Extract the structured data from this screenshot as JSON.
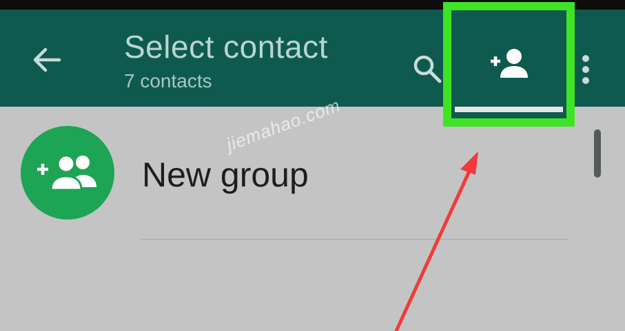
{
  "app_bar": {
    "title": "Select contact",
    "subtitle": "7 contacts",
    "back_icon": "arrow-left-icon",
    "search_icon": "search-icon",
    "add_contact_icon": "add-person-icon",
    "overflow_icon": "more-vert-icon"
  },
  "list": {
    "new_group_label": "New group",
    "new_group_icon": "add-group-icon"
  },
  "watermark": "jiemahao.com",
  "colors": {
    "app_bar": "#0f5a4f",
    "content_background": "#c4c4c4",
    "highlight_box": "#3ee323",
    "avatar_green": "#1da454",
    "annotation_arrow": "#f23a3a"
  }
}
